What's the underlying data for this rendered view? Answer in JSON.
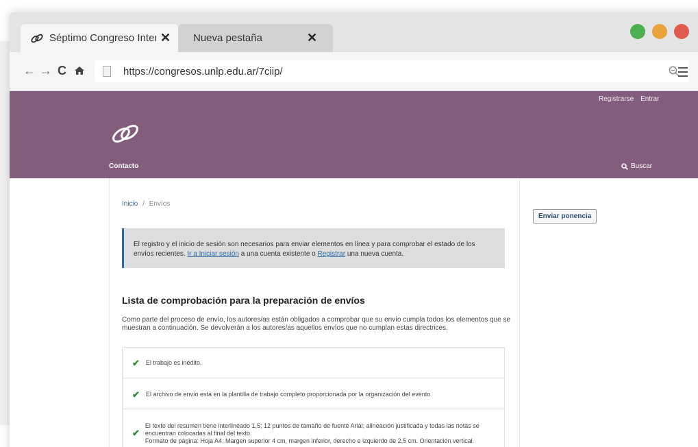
{
  "browser": {
    "tabs": [
      {
        "title": "Séptimo Congreso Intern",
        "close": "✕",
        "active": true
      },
      {
        "title": "Nueva pestaña",
        "close": "✕",
        "active": false
      }
    ],
    "window_dots": [
      "#4caf50",
      "#e8a33c",
      "#e05a4f"
    ],
    "nav": {
      "back": "←",
      "forward": "→",
      "reload": "C",
      "home": "🏠"
    },
    "url": "https://congresos.unlp.edu.ar/7ciip/"
  },
  "site": {
    "header_color": "#845c7c",
    "user_links": {
      "register": "Registrarse",
      "login": "Entrar"
    },
    "nav_contact": "Contacto",
    "search_label": "Buscar"
  },
  "breadcrumb": {
    "home": "Inicio",
    "separator": "/",
    "current": "Envíos"
  },
  "notice": {
    "text_before": "El registro y el inicio de sesión son necesarios para enviar elementos en línea y para comprobar el estado de los envíos recientes. ",
    "link_login": "Ir a Iniciar sesión",
    "text_middle": " a una cuenta existente o ",
    "link_register": "Registrar",
    "text_after": " una nueva cuenta."
  },
  "checklist": {
    "title": "Lista de comprobación para la preparación de envíos",
    "intro": "Como parte del proceso de envío, los autores/as están obligados a comprobar que su envío cumpla todos los elementos que se muestran a continuación. Se devolverán a los autores/as aquellos envíos que no cumplan estas directrices.",
    "items": [
      "El trabajo es inédito.",
      "El archivo de envío está en la plantilla de trabajo completo proporcionada por la organización del evento",
      "El texto del resumen tiene interlineado 1,5; 12 puntos de tamaño de fuente Arial; alineación justificada y todas las notas se encuentran colocadas al final del texto.",
      "Formato de página: Hoja A4. Margen superior 4 cm, margen inferior, derecho e izquierdo de 2,5 cm. Orientación vertical."
    ]
  },
  "sidebar": {
    "submit_button": "Enviar ponencia"
  }
}
